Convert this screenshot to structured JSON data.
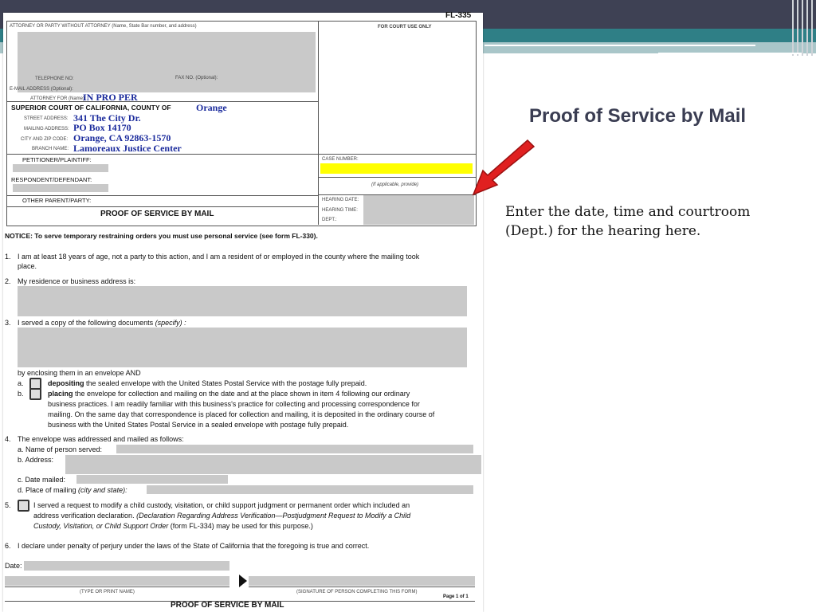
{
  "slide": {
    "title": "Proof of Service by Mail",
    "note": "Enter the date, time and courtroom (Dept.) for the hearing here.",
    "colors": {
      "header_dark": "#3e4154",
      "header_teal": "#2f7f86",
      "arrow": "#e02020",
      "highlight": "#ffff00"
    }
  },
  "form": {
    "form_number": "FL-335",
    "attorney_label": "ATTORNEY OR PARTY WITHOUT ATTORNEY (Name, State Bar number, and address)",
    "court_use_label": "FOR COURT USE ONLY",
    "telephone_label": "TELEPHONE NO:",
    "fax_label": "FAX NO. (Optional):",
    "email_label": "E-MAIL ADDRESS (Optional):",
    "attorney_for_label": "ATTORNEY FOR (Name):",
    "attorney_for_value": "IN PRO PER",
    "court_label": "SUPERIOR COURT OF CALIFORNIA, COUNTY OF",
    "county_value": "Orange",
    "street_label": "STREET ADDRESS:",
    "street_value": "341 The City Dr.",
    "mailing_label": "MAILING ADDRESS:",
    "mailing_value": "PO Box 14170",
    "city_label": "CITY AND ZIP CODE:",
    "city_value": "Orange, CA  92863-1570",
    "branch_label": "BRANCH NAME:",
    "branch_value": "Lamoreaux Justice Center",
    "petitioner_label": "PETITIONER/PLAINTIFF:",
    "respondent_label": "RESPONDENT/DEFENDANT:",
    "other_parent_label": "OTHER PARENT/PARTY:",
    "case_number_label": "CASE NUMBER:",
    "if_applicable": "(If applicable, provide)",
    "hearing_date_label": "HEARING DATE:",
    "hearing_time_label": "HEARING TIME:",
    "dept_label": "DEPT.:",
    "doc_title": "PROOF OF SERVICE BY MAIL",
    "notice": "NOTICE: To serve temporary restraining orders you must use personal service (see form FL-330).",
    "item1_num": "1.",
    "item1_line1": "I am at least 18 years of age, not a party to this action, and I am a resident of or employed in the county where the mailing took",
    "item1_line2": "place.",
    "item2_num": "2.",
    "item2": "My residence or business address is:",
    "item3_num": "3.",
    "item3": "I served a copy of the following documents ",
    "item3_specify": "(specify) :",
    "enclosing": "by enclosing them in an envelope AND",
    "a_letter": "a.",
    "a_bold": "depositing",
    "a_rest": " the sealed envelope with the United States Postal Service with the postage fully prepaid.",
    "b_letter": "b.",
    "b_bold": "placing",
    "b_rest": " the envelope for collection and mailing on the date and at the place shown in item 4 following our ordinary",
    "b_line2": "business practices. I am readily familiar with this business's practice for collecting and processing correspondence for",
    "b_line3": "mailing. On the same day that correspondence is placed for collection and mailing, it is deposited in the ordinary course of",
    "b_line4": "business with the United States Postal Service in a sealed envelope with postage fully prepaid.",
    "item4_num": "4.",
    "item4": "The envelope was addressed and mailed as follows:",
    "item4a": "a.   Name of person served:",
    "item4b": "b.   Address:",
    "item4c": "c.   Date mailed:",
    "item4d": "d.   Place of mailing ",
    "item4d_italic": "(city and state):",
    "item5_num": "5.",
    "item5_line1": "I served a request to modify a child custody, visitation, or child support judgment or permanent order which included an",
    "item5_line2a": "address verification declaration. ",
    "item5_line2b": "(Declaration Regarding Address Verification—Postjudgment Request to Modify a Child",
    "item5_line3a": "Custody, Visitation, or Child Support Order",
    "item5_line3b": " (form FL-334) may be used for this purpose.)",
    "item6_num": "6.",
    "item6": "I declare under penalty of perjury under the laws of the State of California that the foregoing is true and correct.",
    "date_label": "Date:",
    "type_print": "(TYPE OR PRINT NAME)",
    "signature": "(SIGNATURE OF PERSON COMPLETING THIS FORM)",
    "page": "Page 1 of 1",
    "footer_title": "PROOF OF SERVICE BY MAIL"
  }
}
